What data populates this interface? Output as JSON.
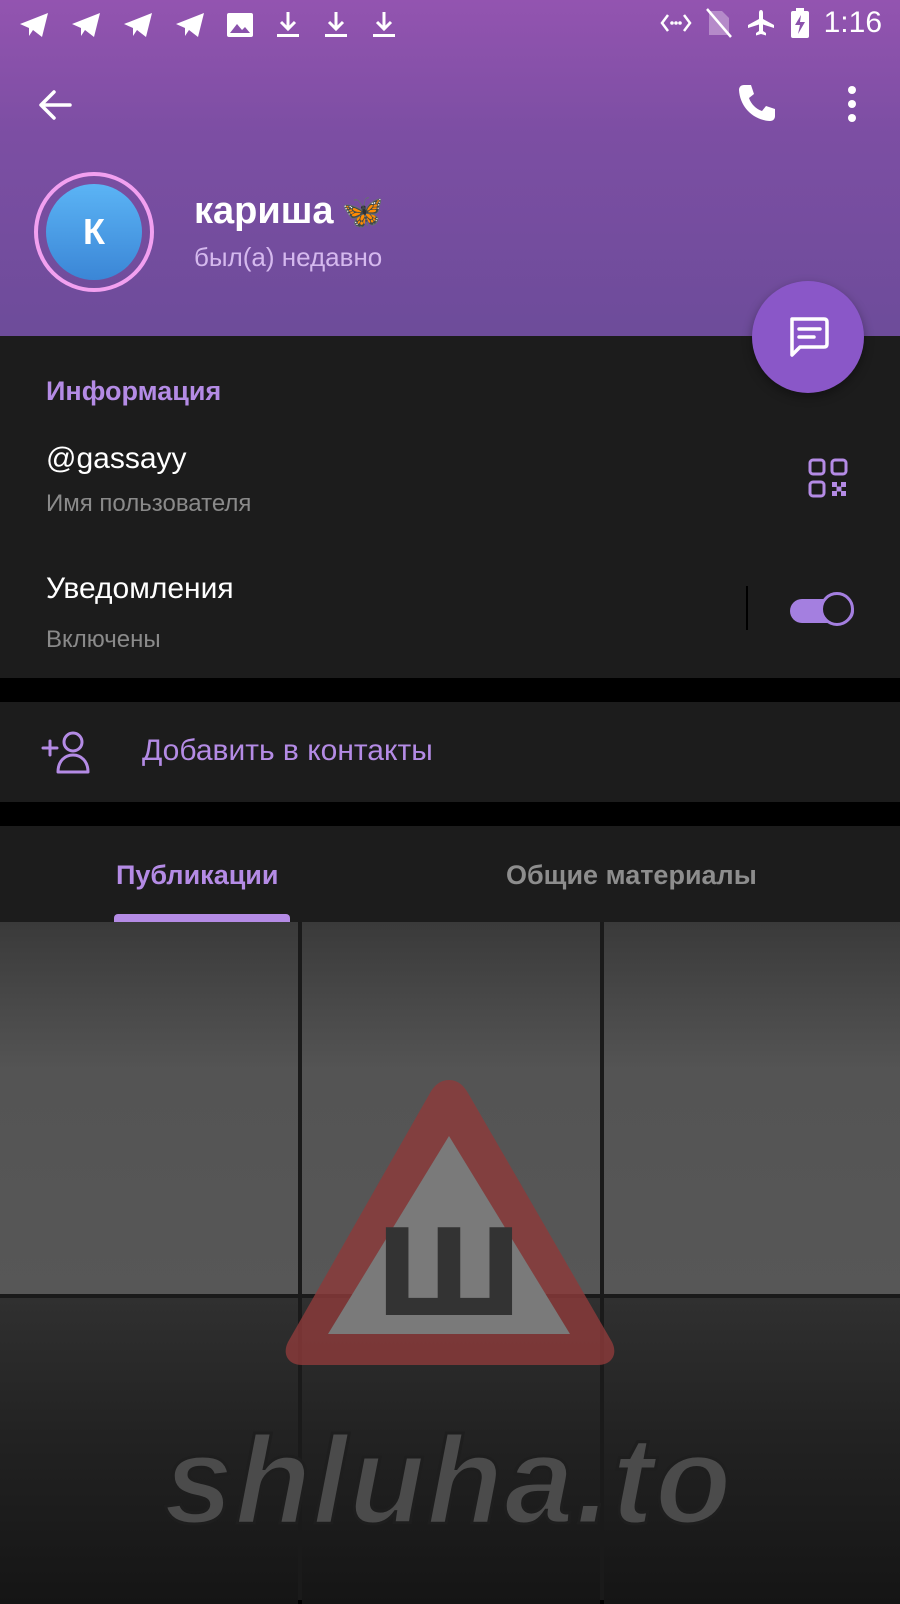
{
  "status_bar": {
    "time": "1:16",
    "left_icons": [
      "telegram-icon",
      "telegram-icon",
      "telegram-icon",
      "telegram-icon",
      "image-icon",
      "download-icon",
      "download-icon",
      "download-icon"
    ],
    "right_icons": [
      "data-saver-icon",
      "no-sim-icon",
      "airplane-icon",
      "battery-charging-icon"
    ]
  },
  "profile": {
    "avatar_letter": "К",
    "name": "кариша",
    "name_emoji": "🦋",
    "status": "был(а) недавно"
  },
  "info": {
    "section_title": "Информация",
    "username": "@gassayy",
    "username_caption": "Имя пользователя",
    "notifications_label": "Уведомления",
    "notifications_value": "Включены",
    "notifications_enabled": true
  },
  "actions": {
    "add_contact_label": "Добавить в контакты"
  },
  "tabs": [
    {
      "label": "Публикации",
      "active": true
    },
    {
      "label": "Общие материалы",
      "active": false
    }
  ],
  "watermark": {
    "glyph": "Ш",
    "text": "shluha.to"
  },
  "colors": {
    "accent": "#b48be5",
    "header_top": "#9354b0",
    "header_bottom": "#6d4c9a",
    "fab": "#8a57c8",
    "surface": "#1c1c1c",
    "avatar_ring": "#f2a0f0",
    "avatar_fill": "#4a9de6"
  }
}
